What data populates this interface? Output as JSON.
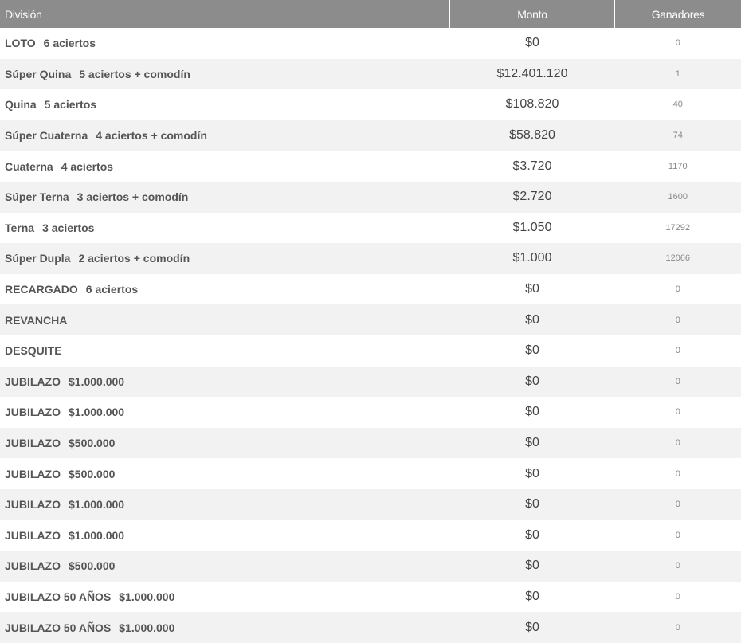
{
  "headers": {
    "division": "División",
    "monto": "Monto",
    "ganadores": "Ganadores"
  },
  "rows": [
    {
      "name": "LOTO",
      "sub": "6 aciertos",
      "monto": "$0",
      "ganadores": "0"
    },
    {
      "name": "Súper Quina",
      "sub": "5 aciertos + comodín",
      "monto": "$12.401.120",
      "ganadores": "1"
    },
    {
      "name": "Quina",
      "sub": "5 aciertos",
      "monto": "$108.820",
      "ganadores": "40"
    },
    {
      "name": "Súper Cuaterna",
      "sub": "4 aciertos + comodín",
      "monto": "$58.820",
      "ganadores": "74"
    },
    {
      "name": "Cuaterna",
      "sub": "4 aciertos",
      "monto": "$3.720",
      "ganadores": "1170"
    },
    {
      "name": "Súper Terna",
      "sub": "3 aciertos + comodín",
      "monto": "$2.720",
      "ganadores": "1600"
    },
    {
      "name": "Terna",
      "sub": "3 aciertos",
      "monto": "$1.050",
      "ganadores": "17292"
    },
    {
      "name": "Súper Dupla",
      "sub": "2 aciertos + comodín",
      "monto": "$1.000",
      "ganadores": "12066"
    },
    {
      "name": "RECARGADO",
      "sub": "6 aciertos",
      "monto": "$0",
      "ganadores": "0"
    },
    {
      "name": "REVANCHA",
      "sub": "",
      "monto": "$0",
      "ganadores": "0"
    },
    {
      "name": "DESQUITE",
      "sub": "",
      "monto": "$0",
      "ganadores": "0"
    },
    {
      "name": "JUBILAZO",
      "sub": "$1.000.000",
      "monto": "$0",
      "ganadores": "0"
    },
    {
      "name": "JUBILAZO",
      "sub": "$1.000.000",
      "monto": "$0",
      "ganadores": "0"
    },
    {
      "name": "JUBILAZO",
      "sub": "$500.000",
      "monto": "$0",
      "ganadores": "0"
    },
    {
      "name": "JUBILAZO",
      "sub": "$500.000",
      "monto": "$0",
      "ganadores": "0"
    },
    {
      "name": "JUBILAZO",
      "sub": "$1.000.000",
      "monto": "$0",
      "ganadores": "0"
    },
    {
      "name": "JUBILAZO",
      "sub": "$1.000.000",
      "monto": "$0",
      "ganadores": "0"
    },
    {
      "name": "JUBILAZO",
      "sub": "$500.000",
      "monto": "$0",
      "ganadores": "0"
    },
    {
      "name": "JUBILAZO 50 AÑOS",
      "sub": "$1.000.000",
      "monto": "$0",
      "ganadores": "0"
    },
    {
      "name": "JUBILAZO 50 AÑOS",
      "sub": "$1.000.000",
      "monto": "$0",
      "ganadores": "0"
    }
  ]
}
